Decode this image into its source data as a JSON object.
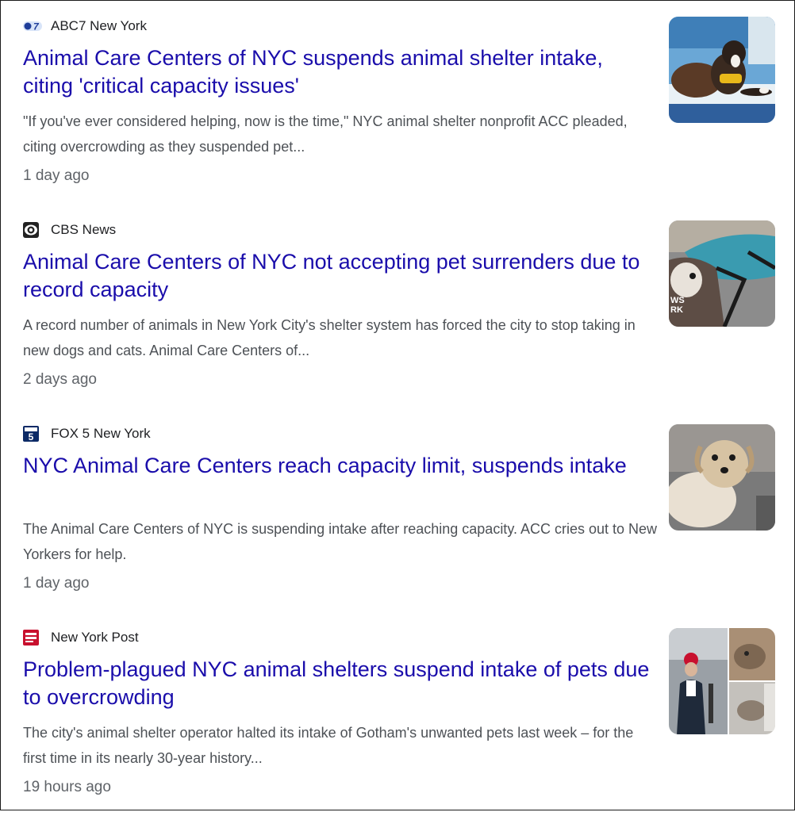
{
  "articles": [
    {
      "source": "ABC7 New York",
      "logo_icon": "abc7-logo-icon",
      "headline": "Animal Care Centers of NYC suspends animal shelter intake, citing 'critical capacity issues'",
      "snippet": "\"If you've ever considered helping, now is the time,\" NYC animal shelter nonprofit ACC pleaded, citing overcrowding as they suspended pet...",
      "time": "1 day ago",
      "thumbnail": "dog-on-pool-float-photo"
    },
    {
      "source": "CBS News",
      "logo_icon": "cbs-eye-logo-icon",
      "headline": "Animal Care Centers of NYC not accepting pet surrenders due to record capacity",
      "snippet": "A record number of animals in New York City's shelter system has forced the city to stop taking in new dogs and cats. Animal Care Centers of...",
      "time": "2 days ago",
      "thumbnail": "dog-in-adopt-me-vest-photo",
      "thumbnail_overlay": "WS\nRK"
    },
    {
      "source": "FOX 5 New York",
      "logo_icon": "fox5-logo-icon",
      "headline": "NYC Animal Care Centers reach capacity limit, suspends intake",
      "snippet": "The Animal Care Centers of NYC is suspending intake after reaching capacity. ACC cries out to New Yorkers for help.",
      "time": "1 day ago",
      "thumbnail": "scruffy-dog-photo"
    },
    {
      "source": "New York Post",
      "logo_icon": "nypost-logo-icon",
      "headline": "Problem-plagued NYC animal shelters suspend intake of pets due to overcrowding",
      "snippet": "The city's animal shelter operator halted its intake of Gotham's unwanted pets last week – for the first time in its nearly 30-year history...",
      "time": "19 hours ago",
      "thumbnail": "press-conference-and-cats-collage-photo"
    }
  ],
  "colors": {
    "headline": "#1a0dab",
    "snippet": "#4d5156",
    "meta": "#5f6368",
    "source": "#202124"
  }
}
